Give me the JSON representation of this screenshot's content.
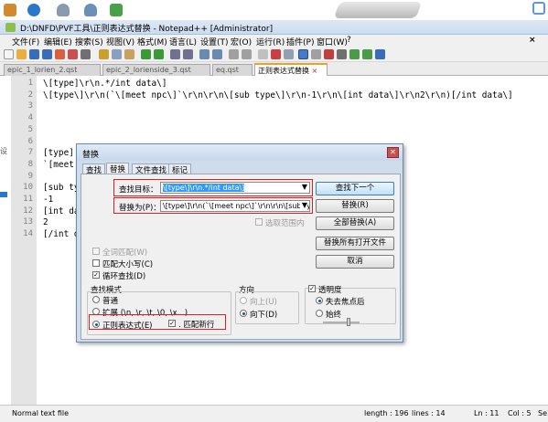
{
  "window": {
    "title": "D:\\DNFD\\PVF工具\\正则表达式替换 - Notepad++ [Administrator]"
  },
  "menu": [
    "文件(F)",
    "编辑(E)",
    "搜索(S)",
    "视图(V)",
    "格式(M)",
    "语言(L)",
    "设置(T)",
    "宏(O)",
    "运行(R)",
    "插件(P)",
    "窗口(W)",
    "?"
  ],
  "tabs": [
    {
      "label": "epic_1_lorien_2.qst"
    },
    {
      "label": "epic_2_lorienside_3.qst"
    },
    {
      "label": "eq.qst"
    },
    {
      "label": "正则表达式替换",
      "active": true
    }
  ],
  "editor": {
    "lines": [
      {
        "num": "1",
        "text": "\\[type]\\r\\n.*/int data\\]"
      },
      {
        "num": "2",
        "text": "\\[type\\]\\r\\n(`\\[meet npc\\]`\\r\\n\\r\\n\\[sub type\\]\\r\\n-1\\r\\n\\[int data\\]\\r\\n2\\r\\n)[/int data\\]"
      },
      {
        "num": "3",
        "text": ""
      },
      {
        "num": "4",
        "text": ""
      },
      {
        "num": "5",
        "text": ""
      },
      {
        "num": "6",
        "text": ""
      },
      {
        "num": "7",
        "text": "[type]"
      },
      {
        "num": "8",
        "text": "`[meet"
      },
      {
        "num": "9",
        "text": ""
      },
      {
        "num": "10",
        "text": "[sub ty"
      },
      {
        "num": "11",
        "text": "-1"
      },
      {
        "num": "12",
        "text": "[int da"
      },
      {
        "num": "13",
        "text": "2"
      },
      {
        "num": "14",
        "text": "[/int d"
      }
    ]
  },
  "dialog": {
    "title": "替换",
    "tabs": [
      "查找",
      "替换",
      "文件查找",
      "标记"
    ],
    "find_label": "查找目标：",
    "find_value": "\\[type\\]\\r\\n.*/int data\\]",
    "replace_label": "替换为(P)：",
    "replace_value": "\\[type\\]\\r\\n(`\\[meet npc\\]`\\r\\n\\r\\n\\[sub type\\]\\r\\n",
    "in_selection": "选取范围内",
    "whole_word": "全词匹配(W)",
    "match_case": "匹配大小写(C)",
    "wrap_around": "循环查找(D)",
    "search_mode_title": "查找模式",
    "mode_normal": "普通",
    "mode_extended": "扩展 (\\n, \\r, \\t, \\0, \\x...)",
    "mode_regex": "正则表达式(E)",
    "dot_newline": ". 匹配新行",
    "direction_title": "方向",
    "dir_up": "向上(U)",
    "dir_down": "向下(D)",
    "transparency": "透明度",
    "on_lose_focus": "失去焦点后",
    "always": "始终",
    "btn_find_next": "查找下一个",
    "btn_replace": "替换(R)",
    "btn_replace_all": "全部替换(A)",
    "btn_replace_all_open": "替换所有打开文件",
    "btn_cancel": "取消"
  },
  "status": {
    "file_type": "Normal text file",
    "length": "length : 196",
    "lines": "lines : 14",
    "ln": "Ln : 11",
    "col": "Col : 5",
    "sel": "Se"
  },
  "colors": {
    "accent_tab": "#f0a020",
    "highlight_border": "#e02020",
    "selection": "#3399ff"
  }
}
